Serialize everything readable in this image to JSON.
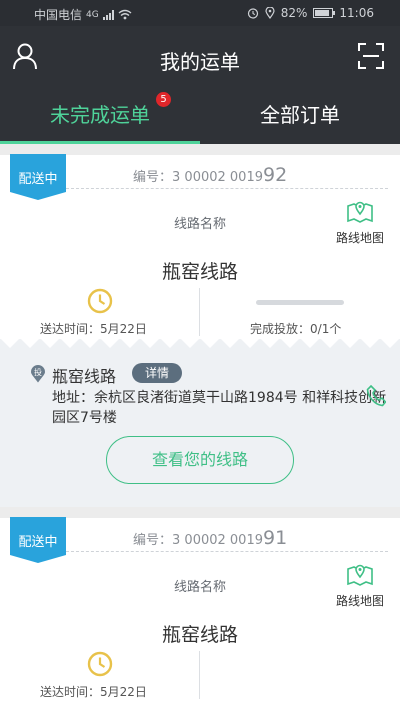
{
  "status_bar": {
    "carrier": "中国电信",
    "network": "4G",
    "battery": "82%",
    "time": "11:06"
  },
  "header": {
    "title": "我的运单",
    "user_icon": "user-icon",
    "scan_icon": "scan-icon"
  },
  "tabs": [
    {
      "label": "未完成运单",
      "badge": "5"
    },
    {
      "label": "全部订单"
    }
  ],
  "orders": [
    {
      "status": "配送中",
      "number_label": "编号：",
      "number_prefix": "3 00002 0019",
      "number_suffix": "92",
      "route_caption": "线路名称",
      "map_label": "路线地图",
      "route_name": "瓶窑线路",
      "deliver_label": "送达时间：",
      "deliver_date": "5月22日",
      "complete_label": "完成投放：",
      "complete_value": "0/1个",
      "progress": 0,
      "detail": {
        "pin_label": "投",
        "route_name": "瓶窑线路",
        "detail_tag": "详情",
        "address": "地址：余杭区良渚街道莫干山路1984号 和祥科技创新园区7号楼",
        "view_button": "查看您的线路"
      }
    },
    {
      "status": "配送中",
      "number_label": "编号：",
      "number_prefix": "3 00002 0019",
      "number_suffix": "91",
      "route_caption": "线路名称",
      "map_label": "路线地图",
      "route_name": "瓶窑线路",
      "deliver_label": "送达时间：",
      "deliver_date": "5月22日"
    }
  ],
  "colors": {
    "accent": "#4fd39a",
    "ribbon": "#29a3dc",
    "header_bg": "#2f3237",
    "badge": "#e0262a",
    "clock": "#e8c24a"
  }
}
